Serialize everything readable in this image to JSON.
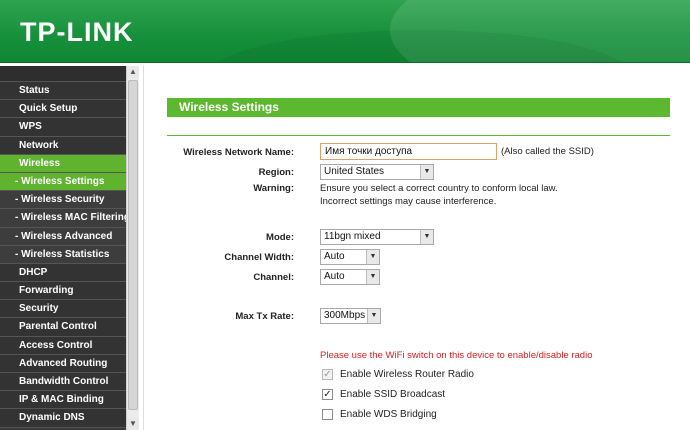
{
  "header": {
    "logo": "TP-LINK"
  },
  "sidebar": {
    "items": [
      {
        "label": "Status",
        "type": "main"
      },
      {
        "label": "Quick Setup",
        "type": "main"
      },
      {
        "label": "WPS",
        "type": "main"
      },
      {
        "label": "Network",
        "type": "main"
      },
      {
        "label": "Wireless",
        "type": "active"
      },
      {
        "label": "- Wireless Settings",
        "type": "sub-current"
      },
      {
        "label": "- Wireless Security",
        "type": "sub"
      },
      {
        "label": "- Wireless MAC Filtering",
        "type": "sub"
      },
      {
        "label": "- Wireless Advanced",
        "type": "sub"
      },
      {
        "label": "- Wireless Statistics",
        "type": "sub"
      },
      {
        "label": "DHCP",
        "type": "main"
      },
      {
        "label": "Forwarding",
        "type": "main"
      },
      {
        "label": "Security",
        "type": "main"
      },
      {
        "label": "Parental Control",
        "type": "main"
      },
      {
        "label": "Access Control",
        "type": "main"
      },
      {
        "label": "Advanced Routing",
        "type": "main"
      },
      {
        "label": "Bandwidth Control",
        "type": "main"
      },
      {
        "label": "IP & MAC Binding",
        "type": "main"
      },
      {
        "label": "Dynamic DNS",
        "type": "main"
      }
    ]
  },
  "main": {
    "title": "Wireless Settings",
    "ssid": {
      "label": "Wireless Network Name:",
      "value": "Имя точки доступа",
      "hint": "(Also called the SSID)"
    },
    "region": {
      "label": "Region:",
      "value": "United States"
    },
    "warning": {
      "label": "Warning:",
      "line1": "Ensure you select a correct country to conform local law.",
      "line2": "Incorrect settings may cause interference."
    },
    "mode": {
      "label": "Mode:",
      "value": "11bgn mixed"
    },
    "channel_width": {
      "label": "Channel Width:",
      "value": "Auto"
    },
    "channel": {
      "label": "Channel:",
      "value": "Auto"
    },
    "max_tx": {
      "label": "Max Tx Rate:",
      "value": "300Mbps"
    },
    "radio_note": "Please use the WiFi switch on this device to enable/disable radio",
    "checkboxes": [
      {
        "label": "Enable Wireless Router Radio",
        "checked": true,
        "disabled": true
      },
      {
        "label": "Enable SSID Broadcast",
        "checked": true,
        "disabled": false
      },
      {
        "label": "Enable WDS Bridging",
        "checked": false,
        "disabled": false
      }
    ]
  }
}
